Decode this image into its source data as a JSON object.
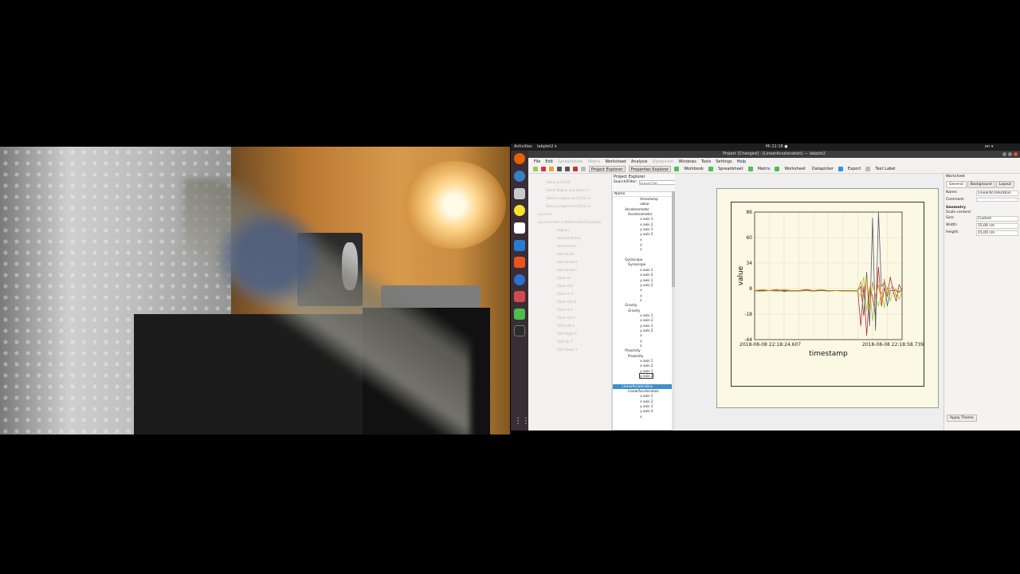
{
  "desktop": {
    "activities": "Activities",
    "app_menu": "labplot2 ▾",
    "clock": "Mi 22:18 ●",
    "keyboard": "en ▾"
  },
  "window": {
    "title": "Project    [Changed] - [LinearAcceleration] — labplot2"
  },
  "menu": [
    "File",
    "Edit",
    "Spreadsheet",
    "Matrix",
    "Worksheet",
    "Analysis",
    "Datapicker",
    "Windows",
    "Tools",
    "Settings",
    "Help"
  ],
  "menu_disabled": [
    false,
    false,
    true,
    true,
    false,
    false,
    true,
    false,
    false,
    false,
    false
  ],
  "toolbar": {
    "project_explorer": "Project Explorer",
    "properties_explorer": "Properties Explorer",
    "workbook": "Workbook",
    "spreadsheet": "Spreadsheet",
    "matrix": "Matrix",
    "worksheet": "Worksheet",
    "datapicker": "Datapicker",
    "export": "Export",
    "text_label": "Text Label"
  },
  "elements_list": [
    "Select and Edit",
    "Select Region and Zoom in",
    "Select x-region and Zoom in",
    "Select y-region and Zoom in",
    "xy-curve",
    "xy-curve from a Mathematical Equation",
    "Legend",
    "Horizontal Axis",
    "Vertical Axis",
    "Auto Scale",
    "Auto Scale X",
    "Auto Scale Y",
    "Zoom In",
    "Zoom Out",
    "Zoom In X",
    "Zoom Out X",
    "Zoom In Y",
    "Zoom Out Y",
    "Shift Left X",
    "Shift Right X",
    "Shift Up Y",
    "Shift Down Y"
  ],
  "explorer": {
    "title": "Project Explorer",
    "filter_label": "Search/Filter:",
    "filter_placeholder": "Search/Filter",
    "column_name": "Name",
    "rows": [
      {
        "label": "timestamp",
        "indent": 9,
        "state": ""
      },
      {
        "label": "value",
        "indent": 9,
        "state": ""
      },
      {
        "label": "Accelerometer",
        "indent": 4,
        "state": ""
      },
      {
        "label": "Accelerometer",
        "indent": 5,
        "state": ""
      },
      {
        "label": "x axis 1",
        "indent": 9,
        "state": ""
      },
      {
        "label": "x axis 2",
        "indent": 9,
        "state": ""
      },
      {
        "label": "y axis 1",
        "indent": 9,
        "state": ""
      },
      {
        "label": "y axis 2",
        "indent": 9,
        "state": ""
      },
      {
        "label": "x",
        "indent": 9,
        "state": ""
      },
      {
        "label": "y",
        "indent": 9,
        "state": ""
      },
      {
        "label": "z",
        "indent": 9,
        "state": ""
      },
      {
        "label": "",
        "indent": 9,
        "state": ""
      },
      {
        "label": "Gyroscope",
        "indent": 4,
        "state": ""
      },
      {
        "label": "Gyroscope",
        "indent": 5,
        "state": ""
      },
      {
        "label": "x axis 1",
        "indent": 9,
        "state": ""
      },
      {
        "label": "x axis 2",
        "indent": 9,
        "state": ""
      },
      {
        "label": "y axis 1",
        "indent": 9,
        "state": ""
      },
      {
        "label": "y axis 2",
        "indent": 9,
        "state": ""
      },
      {
        "label": "x",
        "indent": 9,
        "state": ""
      },
      {
        "label": "y",
        "indent": 9,
        "state": ""
      },
      {
        "label": "z",
        "indent": 9,
        "state": ""
      },
      {
        "label": "Gravity",
        "indent": 4,
        "state": ""
      },
      {
        "label": "Gravity",
        "indent": 5,
        "state": ""
      },
      {
        "label": "x axis 1",
        "indent": 9,
        "state": ""
      },
      {
        "label": "x axis 2",
        "indent": 9,
        "state": ""
      },
      {
        "label": "y axis 1",
        "indent": 9,
        "state": ""
      },
      {
        "label": "y axis 2",
        "indent": 9,
        "state": ""
      },
      {
        "label": "x",
        "indent": 9,
        "state": ""
      },
      {
        "label": "y",
        "indent": 9,
        "state": ""
      },
      {
        "label": "z",
        "indent": 9,
        "state": ""
      },
      {
        "label": "Proximity",
        "indent": 4,
        "state": ""
      },
      {
        "label": "Proximity",
        "indent": 5,
        "state": ""
      },
      {
        "label": "x axis 1",
        "indent": 9,
        "state": ""
      },
      {
        "label": "x axis 2",
        "indent": 9,
        "state": ""
      },
      {
        "label": "y axis 1",
        "indent": 9,
        "state": ""
      },
      {
        "label": "y axis 2",
        "indent": 9,
        "state": "edit"
      },
      {
        "label": "",
        "indent": 9,
        "state": ""
      },
      {
        "label": "LinearAcceleration",
        "indent": 3,
        "state": "sel"
      },
      {
        "label": "LinearAcceleration",
        "indent": 5,
        "state": ""
      },
      {
        "label": "x axis 1",
        "indent": 9,
        "state": ""
      },
      {
        "label": "x axis 2",
        "indent": 9,
        "state": ""
      },
      {
        "label": "y axis 1",
        "indent": 9,
        "state": ""
      },
      {
        "label": "y axis 2",
        "indent": 9,
        "state": ""
      },
      {
        "label": "x",
        "indent": 9,
        "state": ""
      }
    ]
  },
  "properties": {
    "title": "Worksheet",
    "tabs": [
      "General",
      "Background",
      "Layout"
    ],
    "name_label": "Name:",
    "name_value": "LinearAcceleration",
    "comment_label": "Comment:",
    "comment_value": "",
    "geometry": "Geometry",
    "scale_label": "Scale content:",
    "size_label": "Size:",
    "size_value": "Custom",
    "width_label": "Width:",
    "width_value": "15,00 cm",
    "height_label": "Height:",
    "height_value": "15,00 cm",
    "apply_theme": "Apply Theme"
  },
  "colors": {
    "plot_background": "#fbf9e4",
    "selection": "#3d8fce",
    "launcher": "#3a2d35"
  },
  "chart_data": {
    "type": "line",
    "xlabel": "timestamp",
    "ylabel": "value",
    "ylim": [
      -44,
      86
    ],
    "yticks": [
      86,
      60,
      34,
      8,
      -18,
      -44
    ],
    "xtick_labels": [
      "2018-08-08 22:18:24.607",
      "2018-08-08 22:18:58.739"
    ],
    "x": [
      0,
      0.05,
      0.1,
      0.15,
      0.2,
      0.25,
      0.3,
      0.35,
      0.4,
      0.45,
      0.5,
      0.55,
      0.6,
      0.65,
      0.7,
      0.72,
      0.74,
      0.76,
      0.78,
      0.8,
      0.82,
      0.84,
      0.86,
      0.88,
      0.9,
      0.92,
      0.94,
      0.96,
      0.98,
      1.0
    ],
    "series": [
      {
        "color": "#c0262d",
        "values": [
          6,
          6,
          6,
          7,
          5,
          6,
          6,
          7,
          6,
          6,
          6,
          6,
          6,
          6,
          6,
          -30,
          10,
          -40,
          8,
          0,
          -20,
          30,
          -10,
          8,
          0,
          20,
          5,
          -5,
          12,
          6
        ]
      },
      {
        "color": "#9acd32",
        "values": [
          5,
          5,
          6,
          5,
          6,
          5,
          5,
          6,
          5,
          6,
          5,
          6,
          5,
          5,
          5,
          0,
          20,
          -15,
          10,
          -25,
          0,
          -10,
          5,
          -12,
          10,
          -5,
          5,
          8,
          -3,
          5
        ]
      },
      {
        "color": "#555577",
        "values": [
          6,
          6,
          6,
          6,
          6,
          6,
          6,
          6,
          6,
          6,
          6,
          6,
          6,
          6,
          6,
          10,
          -20,
          25,
          -30,
          80,
          -35,
          86,
          10,
          14,
          -10,
          6,
          6,
          6,
          4,
          6
        ]
      },
      {
        "color": "#e07b22",
        "values": [
          6,
          7,
          6,
          6,
          7,
          6,
          6,
          6,
          6,
          7,
          6,
          6,
          6,
          6,
          6,
          15,
          0,
          20,
          -12,
          15,
          0,
          12,
          -4,
          18,
          2,
          8,
          10,
          0,
          6,
          6
        ]
      }
    ]
  }
}
